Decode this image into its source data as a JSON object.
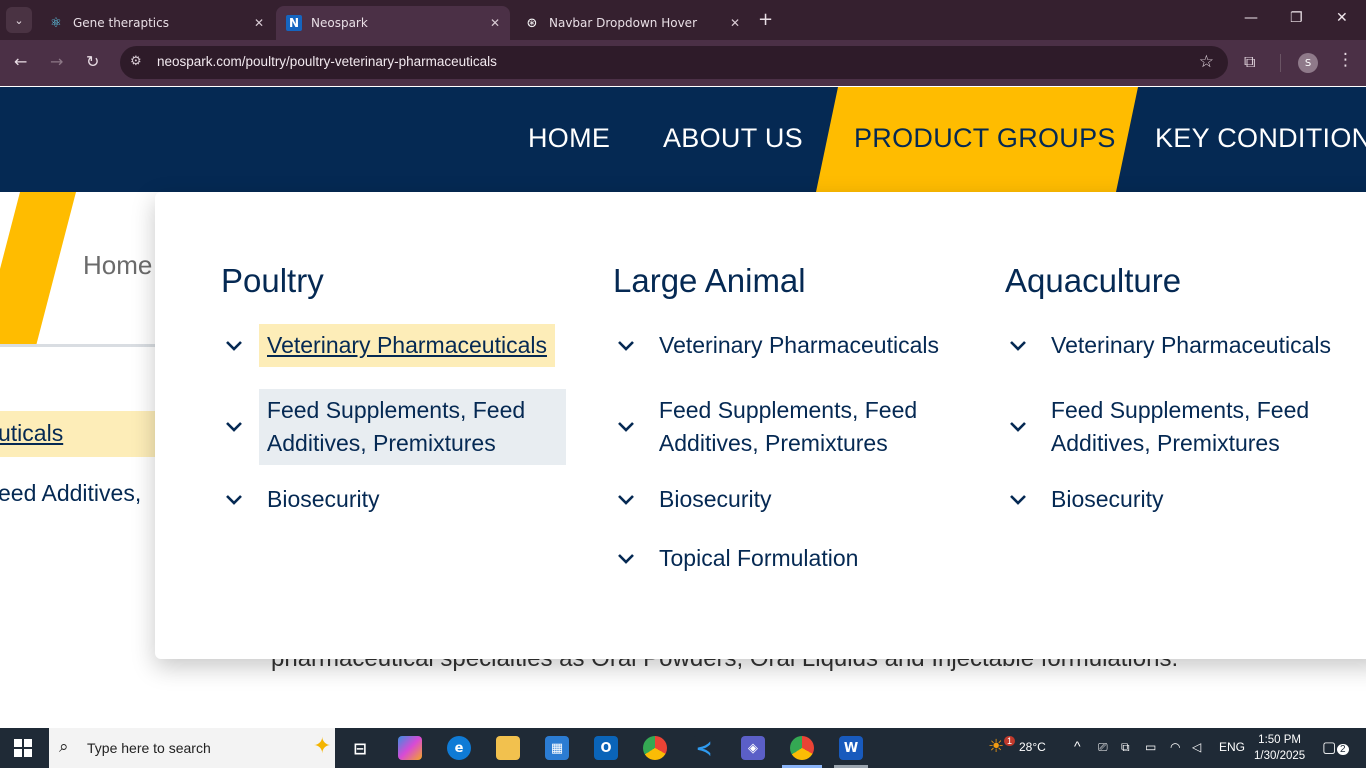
{
  "browser": {
    "tabs": [
      {
        "title": "Gene theraptics",
        "icon": "react-icon"
      },
      {
        "title": "Neospark",
        "icon": "neospark-n-icon"
      },
      {
        "title": "Navbar Dropdown Hover",
        "icon": "openai-icon"
      }
    ],
    "url": "neospark.com/poultry/poultry-veterinary-pharmaceuticals",
    "profile_initial": "S"
  },
  "site": {
    "nav": {
      "items": [
        "HOME",
        "ABOUT US",
        "PRODUCT GROUPS",
        "KEY CONDITIONS"
      ],
      "active_index": 2
    },
    "background": {
      "breadcrumb_home": "Home",
      "sidebar_link_fragment": "uticals",
      "sidebar_text_fragment": "eed Additives,",
      "paragraph_fragment": "pharmaceutical specialties as Oral Powders, Oral Liquids and Injectable formulations."
    },
    "mega_menu": {
      "columns": [
        {
          "title": "Poultry",
          "items": [
            "Veterinary Pharmaceuticals",
            "Feed Supplements, Feed Additives, Premixtures",
            "Biosecurity"
          ]
        },
        {
          "title": "Large Animal",
          "items": [
            "Veterinary Pharmaceuticals",
            "Feed Supplements, Feed Additives, Premixtures",
            "Biosecurity",
            "Topical Formulation"
          ]
        },
        {
          "title": "Aquaculture",
          "items": [
            "Veterinary Pharmaceuticals",
            "Feed Supplements, Feed Additives, Premixtures",
            "Biosecurity"
          ]
        }
      ]
    },
    "colors": {
      "navy": "#052953",
      "accent_yellow": "#ffbc00",
      "highlight": "#fdedb8"
    }
  },
  "taskbar": {
    "search_placeholder": "Type here to search",
    "weather": "28°C",
    "weather_badge": "1",
    "language": "ENG",
    "time": "1:50 PM",
    "date": "1/30/2025",
    "notifications": "2"
  }
}
